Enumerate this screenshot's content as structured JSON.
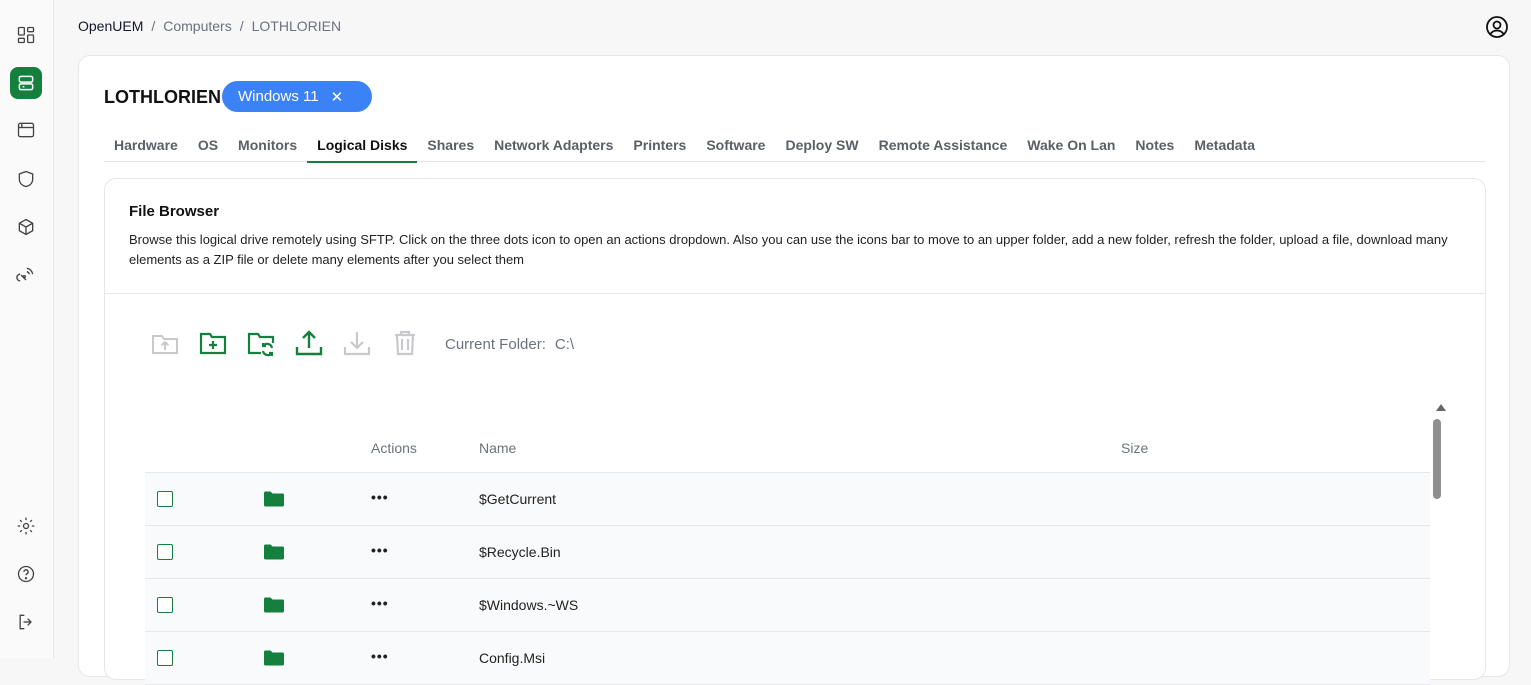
{
  "app": {
    "name": "OpenUEM"
  },
  "breadcrumb": [
    "OpenUEM",
    "Computers",
    "LOTHLORIEN"
  ],
  "computer": {
    "name": "LOTHLORIEN",
    "os": "Windows 11",
    "os_badge_close": "✕"
  },
  "tabs": [
    "Hardware",
    "OS",
    "Monitors",
    "Logical Disks",
    "Shares",
    "Network Adapters",
    "Printers",
    "Software",
    "Deploy SW",
    "Remote Assistance",
    "Wake On Lan",
    "Notes",
    "Metadata"
  ],
  "active_tab": "Logical Disks",
  "file_browser": {
    "title": "File Browser",
    "description": "Browse this logical drive remotely using SFTP. Click on the three dots icon to open an actions dropdown. Also you can use the icons bar to move to an upper folder, add a new folder, refresh the folder, upload a file, download many elements as a ZIP file or delete many elements after you select them",
    "current_folder_label": "Current Folder:",
    "current_folder": "C:\\",
    "toolbar": [
      {
        "icon": "folder-up-icon",
        "enabled": false
      },
      {
        "icon": "folder-add-icon",
        "enabled": true
      },
      {
        "icon": "folder-refresh-icon",
        "enabled": true
      },
      {
        "icon": "upload-icon",
        "enabled": true
      },
      {
        "icon": "download-icon",
        "enabled": false
      },
      {
        "icon": "trash-icon",
        "enabled": false
      }
    ]
  },
  "table": {
    "headers": {
      "actions": "Actions",
      "name": "Name",
      "size": "Size"
    },
    "rows": [
      {
        "name": "$GetCurrent",
        "actions": "•••"
      },
      {
        "name": "$Recycle.Bin",
        "actions": "•••"
      },
      {
        "name": "$Windows.~WS",
        "actions": "•••"
      },
      {
        "name": "Config.Msi",
        "actions": "•••"
      }
    ]
  },
  "colors": {
    "accent": "#15803d",
    "badge": "#3b82f6",
    "disabled": "#c7c9cc"
  }
}
